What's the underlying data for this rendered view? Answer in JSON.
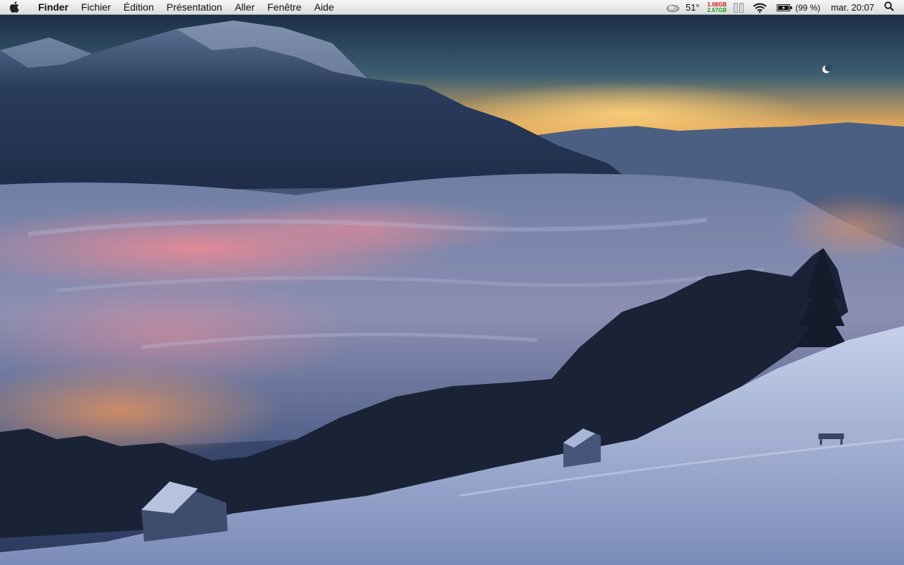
{
  "menubar": {
    "app_name": "Finder",
    "items": [
      "Fichier",
      "Édition",
      "Présentation",
      "Aller",
      "Fenêtre",
      "Aide"
    ],
    "status": {
      "temperature": "51°",
      "memory_used": "1.08GB",
      "memory_free": "2.67GB",
      "battery_percent": "(99 %)",
      "clock": "mar. 20:07"
    }
  },
  "icons": {
    "apple": "apple-icon",
    "weather": "cloud-icon",
    "wifi": "wifi-icon",
    "battery": "battery-icon",
    "search": "magnifier-icon"
  },
  "colors": {
    "menubar_bg": "#e8e8e8",
    "memory_used": "#c81414",
    "memory_free": "#1a9c1a"
  }
}
